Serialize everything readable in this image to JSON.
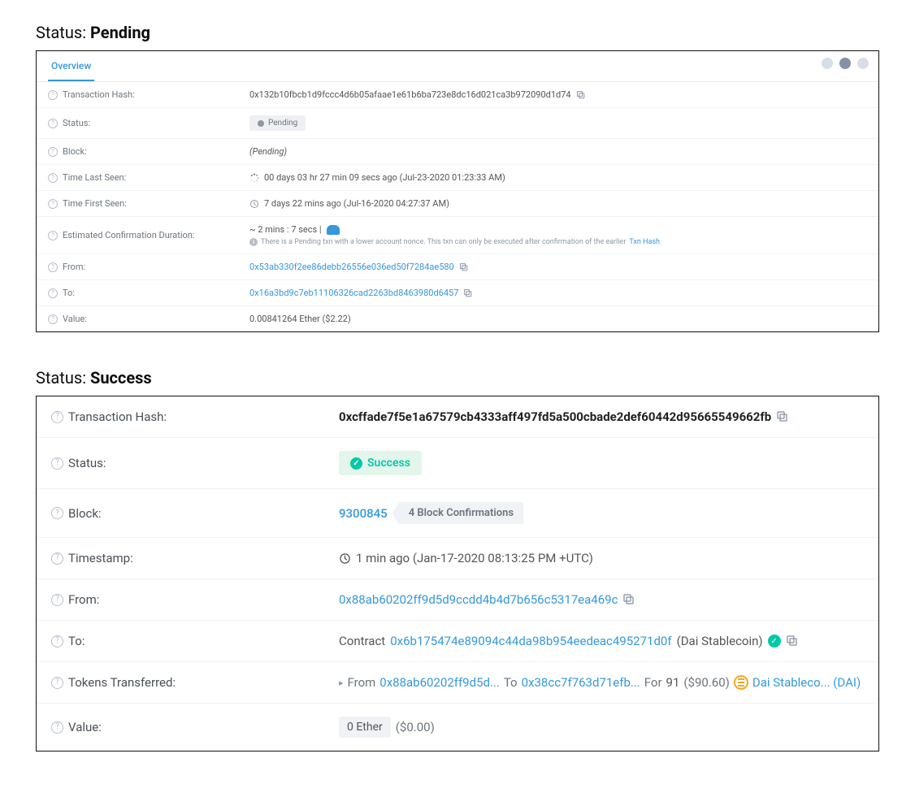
{
  "pending": {
    "section_title_prefix": "Status: ",
    "section_title_status": "Pending",
    "tab_overview": "Overview",
    "labels": {
      "tx_hash": "Transaction Hash:",
      "status": "Status:",
      "block": "Block:",
      "time_last_seen": "Time Last Seen:",
      "time_first_seen": "Time First Seen:",
      "est_conf_duration": "Estimated Confirmation Duration:",
      "from": "From:",
      "to": "To:",
      "value": "Value:"
    },
    "tx_hash": "0x132b10fbcb1d9fccc4d6b05afaae1e61b6ba723e8dc16d021ca3b972090d1d74",
    "status_badge": "Pending",
    "block": "(Pending)",
    "time_last_seen": "00 days 03 hr 27 min 09 secs ago (Jul-23-2020 01:23:33 AM)",
    "time_first_seen": "7 days 22 mins ago (Jul-16-2020 04:27:37 AM)",
    "est_duration": "~ 2 mins : 7 secs |",
    "est_note_prefix": "There is a Pending txn with a lower account nonce. This txn can only be executed after confirmation of the earlier",
    "est_note_link": "Txn Hash",
    "from": "0x53ab330f2ee86debb26556e036ed50f7284ae580",
    "to": "0x16a3bd9c7eb11106326cad2263bd8463980d6457",
    "value": "0.00841264 Ether ($2.22)"
  },
  "success": {
    "section_title_prefix": "Status: ",
    "section_title_status": "Success",
    "labels": {
      "tx_hash": "Transaction Hash:",
      "status": "Status:",
      "block": "Block:",
      "timestamp": "Timestamp:",
      "from": "From:",
      "to": "To:",
      "tokens_transferred": "Tokens Transferred:",
      "value": "Value:"
    },
    "tx_hash": "0xcffade7f5e1a67579cb4333aff497fd5a500cbade2def60442d95665549662fb",
    "status_badge": "Success",
    "block_number": "9300845",
    "block_confirmations": "4 Block Confirmations",
    "timestamp": "1 min ago (Jan-17-2020 08:13:25 PM +UTC)",
    "from": "0x88ab60202ff9d5d9ccdd4b4d7b656c5317ea469c",
    "to_prefix": "Contract",
    "to_addr": "0x6b175474e89094c44da98b954eedeac495271d0f",
    "to_suffix": "(Dai Stablecoin)",
    "tokens": {
      "from_label": "From",
      "from_addr": "0x88ab60202ff9d5d...",
      "to_label": "To",
      "to_addr": "0x38cc7f763d71efb...",
      "for_label": "For",
      "amount": "91",
      "amount_usd": "($90.60)",
      "token_name": "Dai Stableco... (DAI)"
    },
    "value_pill": "0 Ether",
    "value_usd": "($0.00)"
  }
}
